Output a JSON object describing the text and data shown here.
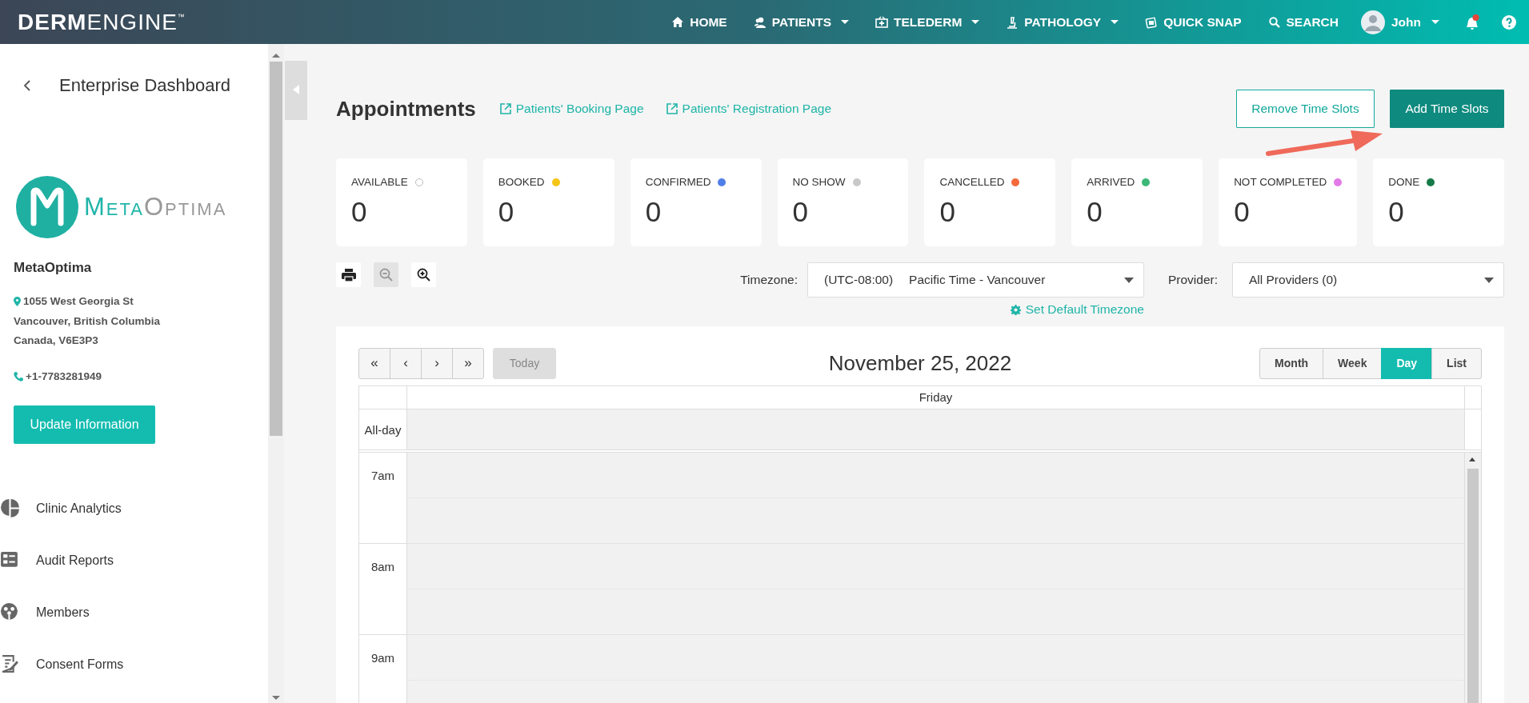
{
  "top_bar": {
    "brand": "**DERM**ENGINE$^{™}$",
    "nav": [
      {
        "label": "HOME",
        "dropdown": false
      },
      {
        "label": "PATIENTS",
        "dropdown": true
      },
      {
        "label": "TELEDERM",
        "dropdown": true
      },
      {
        "label": "PATHOLOGY",
        "dropdown": true
      },
      {
        "label": "QUICK SNAP",
        "dropdown": false
      },
      {
        "label": "SEARCH",
        "dropdown": false
      }
    ],
    "user": {
      "name": "John",
      "dropdown": true
    },
    "notifications": {
      "unread": true
    }
  },
  "sidebar": {
    "back_title": "Enterprise Dashboard",
    "logo": {
      "first": "Meta",
      "second": "Optima"
    },
    "org_name": "MetaOptima",
    "address": [
      "1055 West Georgia St",
      "Vancouver, British Columbia",
      "Canada, V6E3P3"
    ],
    "phone": "+1-7783281949",
    "update_button": "Update Information",
    "menu": [
      "Clinic Analytics",
      "Audit Reports",
      "Members",
      "Consent Forms"
    ]
  },
  "header": {
    "title": "Appointments",
    "links": [
      "Patients' Booking Page",
      "Patients' Registration Page"
    ],
    "buttons": [
      {
        "label": "Remove Time Slots",
        "kind": "outline"
      },
      {
        "label": "Add Time Slots",
        "kind": "primary"
      }
    ]
  },
  "status_cards": [
    {
      "label": "AVAILABLE",
      "color": "#ffffff",
      "count": "0"
    },
    {
      "label": "BOOKED",
      "color": "#f5c518",
      "count": "0"
    },
    {
      "label": "CONFIRMED",
      "color": "#4f7fe6",
      "count": "0"
    },
    {
      "label": "NO SHOW",
      "color": "#c8c8c8",
      "count": "0"
    },
    {
      "label": "CANCELLED",
      "color": "#f46a3c",
      "count": "0"
    },
    {
      "label": "ARRIVED",
      "color": "#3bb878",
      "count": "0"
    },
    {
      "label": "NOT COMPLETED",
      "color": "#e27ae8",
      "count": "0"
    },
    {
      "label": "DONE",
      "color": "#167a48",
      "count": "0"
    }
  ],
  "toolbar": {
    "zoom_out_disabled": true,
    "timezone_label": "Timezone:",
    "timezone": {
      "offset": "(UTC-08:00)",
      "name": "Pacific Time - Vancouver"
    },
    "set_default": "Set Default Timezone",
    "provider_label": "Provider:",
    "provider": "All Providers (0)"
  },
  "calendar": {
    "nav": [
      {
        "label": "«"
      },
      {
        "label": "‹"
      },
      {
        "label": "›"
      },
      {
        "label": "»"
      }
    ],
    "today": {
      "label": "Today",
      "disabled": true
    },
    "date": "November 25, 2022",
    "views": [
      {
        "label": "Month",
        "selected": false
      },
      {
        "label": "Week",
        "selected": false
      },
      {
        "label": "Day",
        "selected": true
      },
      {
        "label": "List",
        "selected": false
      }
    ],
    "day_header": "Friday",
    "all_day": "All-day",
    "hours": [
      "7am",
      "8am",
      "9am"
    ]
  }
}
